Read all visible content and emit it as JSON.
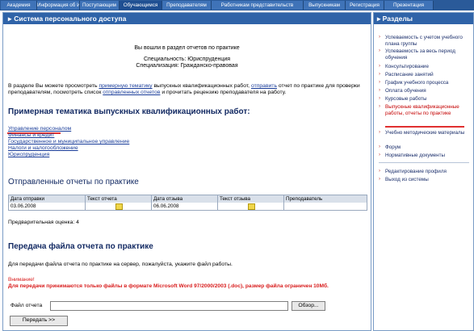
{
  "nav": {
    "tabs": [
      "Академия",
      "Информация об ИПС",
      "Поступающим",
      "Обучающимся",
      "Преподавателям",
      "Работникам представительств",
      "Выпускникам",
      "Регистрация",
      "Презентация"
    ]
  },
  "main": {
    "header": "Система персонального доступа",
    "intro": "Вы вошли в раздел отчетов по практике",
    "specialty": "Специальность: Юриспруденция",
    "specialization": "Специализация: Гражданско-правовая",
    "description_before_link1": "В разделе Вы можете просмотреть ",
    "link_topics": "примерную тематику",
    "description_mid1": " выпускных квалификационных работ, ",
    "link_send": "отправить",
    "description_mid2": " отчет по практике для проверки преподавателям, посмотреть список ",
    "link_sent": "отправленных отчетов",
    "description_end": " и прочитать рецензию преподавателя на работу.",
    "topics_title": "Примерная тематика выпускных квалификационных работ:",
    "topics": [
      "Управление персоналом",
      "Финансы и кредит",
      "Государственное и муниципальное управление",
      "Налоги и налогообложение",
      "Юриспруденция"
    ],
    "reports_title": "Отправленные отчеты по практике",
    "table": {
      "headers": [
        "Дата отправки",
        "Текст отчета",
        "Дата отзыва",
        "Текст отзыва",
        "Преподаватель"
      ],
      "rows": [
        [
          "03.06.2008",
          "",
          "06.06.2008",
          "",
          ""
        ]
      ]
    },
    "grade_label": "Предварительная оценка:",
    "grade_value": "4",
    "upload_title": "Передача файла отчета по практике",
    "upload_hint": "Для передачи файла отчета по практике на сервер, пожалуйста, укажите файл работы.",
    "warning_title": "Внимание!",
    "warning_text": "Для передачи принимаются только файлы в формате Microsoft Word 97/2000/2003 (.doc), размер файла ограничен 10Мб.",
    "file_label": "Файл отчета",
    "browse_button": "Обзор...",
    "submit_button": "Передать >>"
  },
  "sidebar": {
    "header": "Разделы",
    "items": [
      "Успеваемость с учетом учебного плана группы",
      "Успеваемость за весь период обучения",
      "Консультирование",
      "Расписание занятий",
      "График учебного процесса",
      "Оплата обучения",
      "Курсовые работы",
      "Выпускные квалификационные работы, отчеты по практике",
      "Учебно методические материалы",
      "Форум",
      "Нормативные документы",
      "Редактирование профиля",
      "Выход из системы"
    ]
  },
  "colors": {
    "nav_bg": "#2a5a99",
    "header_bg": "#2f63a8",
    "link": "#1a3d9a",
    "warning": "#d81c1c",
    "active_sidebar": "#c40000"
  }
}
